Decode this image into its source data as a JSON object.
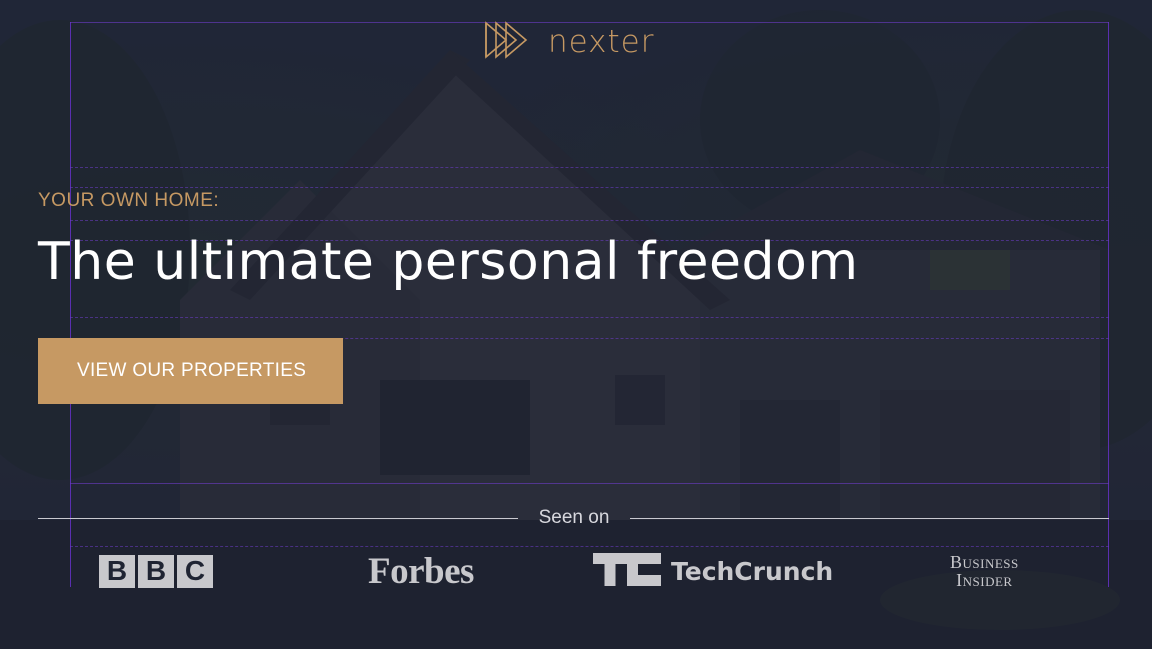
{
  "brand": {
    "name": "nexter",
    "accent_color": "#c69963",
    "logo_icon": "triple-play-arrows-icon"
  },
  "hero": {
    "kicker": "YOUR OWN HOME:",
    "headline": "The ultimate personal freedom",
    "cta_label": "VIEW OUR PROPERTIES",
    "background": "dark-house-photo"
  },
  "seen_on": {
    "label": "Seen on",
    "logos": [
      {
        "name": "BBC",
        "letters": [
          "B",
          "B",
          "C"
        ]
      },
      {
        "name": "Forbes",
        "text": "Forbes"
      },
      {
        "name": "TechCrunch",
        "text": "TechCrunch"
      },
      {
        "name": "Business Insider",
        "lines": [
          "Business",
          "Insider"
        ]
      }
    ]
  }
}
